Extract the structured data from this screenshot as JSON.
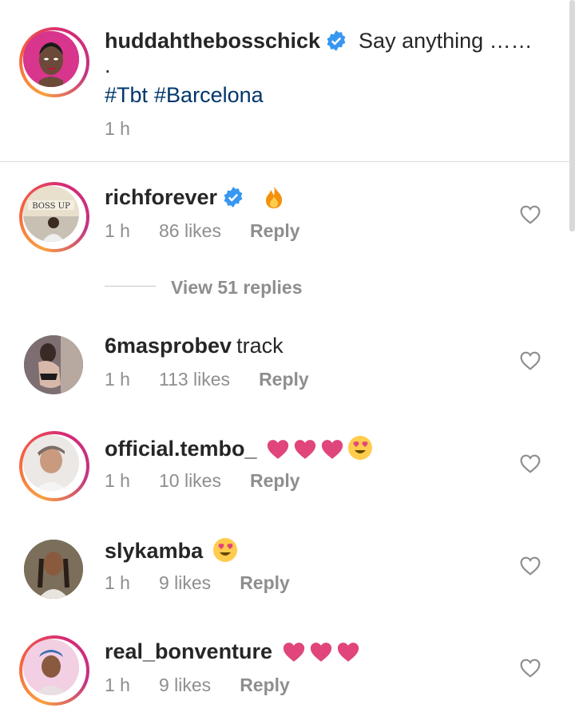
{
  "caption": {
    "username": "huddahthebosschick",
    "verified": true,
    "text": "Say anything ……",
    "dot": ".",
    "hashtags": [
      "#Tbt",
      "#Barcelona"
    ],
    "time": "1 h"
  },
  "comments": [
    {
      "username": "richforever",
      "verified": true,
      "text": "",
      "emoji": "fire",
      "time": "1 h",
      "likes": "86 likes",
      "reply": "Reply"
    },
    {
      "username": "6masprobev",
      "verified": false,
      "text": "track",
      "emoji": "",
      "time": "1 h",
      "likes": "113 likes",
      "reply": "Reply"
    },
    {
      "username": "official.tembo_",
      "verified": false,
      "text": "",
      "emoji": "hearts-3 + heart-eyes",
      "time": "1 h",
      "likes": "10 likes",
      "reply": "Reply"
    },
    {
      "username": "slykamba",
      "verified": false,
      "text": "",
      "emoji": "heart-eyes",
      "time": "1 h",
      "likes": "9 likes",
      "reply": "Reply"
    },
    {
      "username": "real_bonventure",
      "verified": false,
      "text": "",
      "emoji": "hearts-3",
      "time": "1 h",
      "likes": "9 likes",
      "reply": "Reply"
    }
  ],
  "view_replies": "View 51 replies",
  "avatar_text": {
    "richforever": "BOSS UP"
  },
  "colors": {
    "link": "#00376b",
    "verified": "#3897f0",
    "meta": "#8e8e8e",
    "heart_emoji": "#e0457b"
  }
}
